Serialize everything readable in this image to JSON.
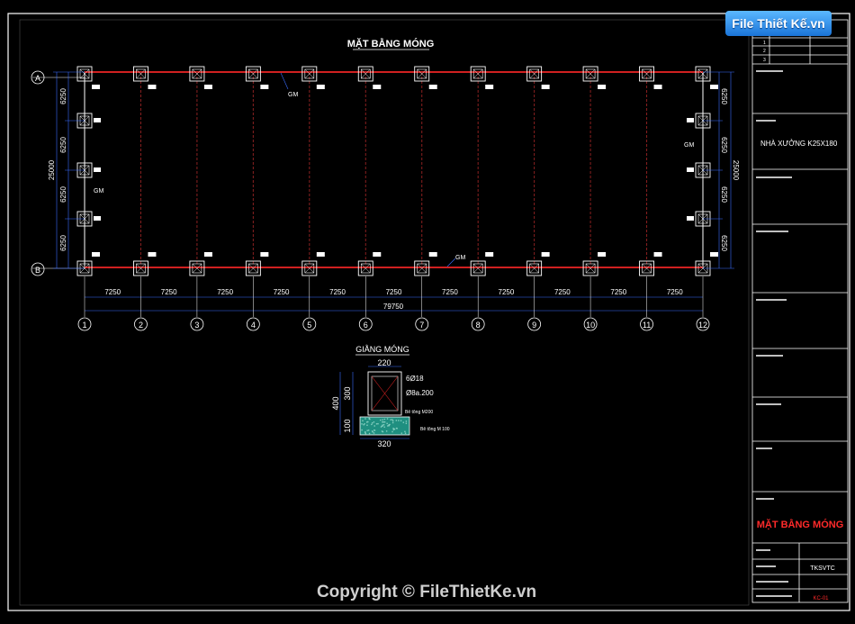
{
  "logo": {
    "text": "File Thiết Kế.vn"
  },
  "drawing": {
    "title": "MẶT BẰNG MÓNG",
    "grid_rows": [
      "A",
      "B"
    ],
    "grid_cols": [
      "1",
      "2",
      "3",
      "4",
      "5",
      "6",
      "7",
      "8",
      "9",
      "10",
      "11",
      "12"
    ],
    "bay_dims": [
      "7250",
      "7250",
      "7250",
      "7250",
      "7250",
      "7250",
      "7250",
      "7250",
      "7250",
      "7250",
      "7250"
    ],
    "total_length": "79750",
    "span_dims": [
      "6250",
      "6250",
      "6250",
      "6250"
    ],
    "total_width": "25000",
    "beam_tags": {
      "top": "GM",
      "bottom": "GM",
      "left": "GM",
      "right": "GM"
    }
  },
  "detail": {
    "title": "GIẰNG MÓNG",
    "width_top": "220",
    "width_bottom": "320",
    "height_total": "400",
    "height_beam": "300",
    "height_lean": "100",
    "label_rebar": "6Ø18",
    "label_stirrup": "Ø8a.200",
    "label_concrete": "Bê tông M200",
    "label_lean_concrete": "Bê tông M 100"
  },
  "titleblock": {
    "revision_rows": [
      "1",
      "2",
      "3"
    ],
    "project_text": "NHÀ XƯỞNG K25X180",
    "sheet_title": "MẶT BẰNG MÓNG",
    "scale_value": "TKSVTC",
    "sheet_number": "KC-01"
  },
  "footer": {
    "copyright": "Copyright © FileThietKe.vn"
  },
  "colors": {
    "frame": "#ffffff",
    "beam_red": "#d02020",
    "grid_line": "#8a2020",
    "dimension_blue": "#3a6cff",
    "title_red": "#ff2a2a"
  }
}
